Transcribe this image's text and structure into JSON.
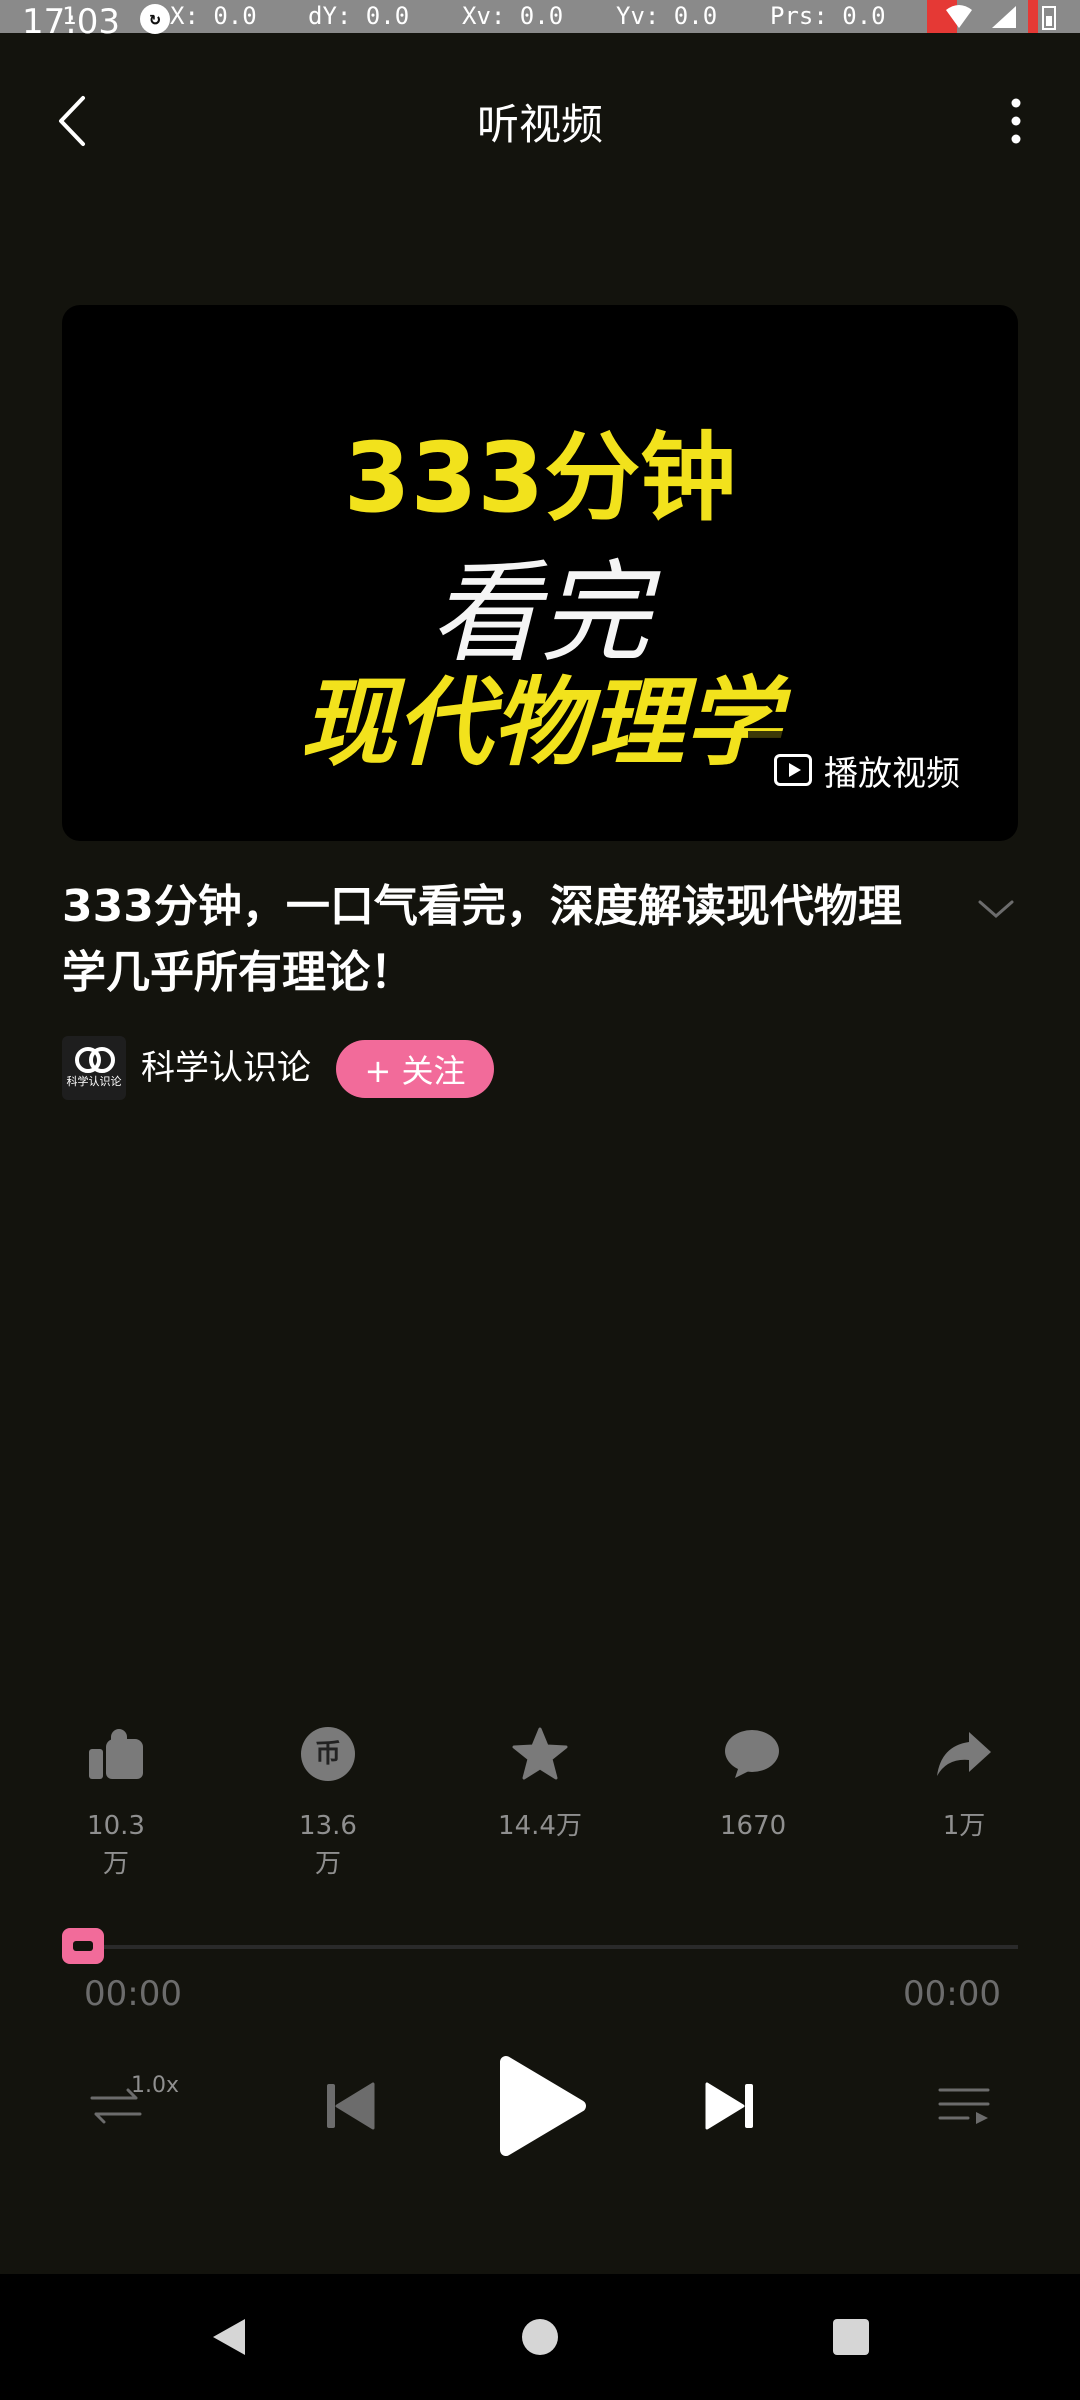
{
  "status_bar": {
    "time": "17:03",
    "pointer": "1",
    "dx": "X: 0.0",
    "dy": "dY: 0.0",
    "xv": "Xv: 0.0",
    "yv": "Yv: 0.0",
    "prs": "Prs: 0.0",
    "icons": [
      "notification-icon",
      "wifi-icon",
      "signal-icon",
      "battery-icon"
    ]
  },
  "header": {
    "title": "听视频",
    "back_icon": "chevron-left-icon",
    "more_icon": "more-vertical-icon"
  },
  "video": {
    "thumbnail_line1": "333分钟",
    "thumbnail_line2": "看完",
    "thumbnail_line3": "现代物理学",
    "play_video_label": "播放视频",
    "title": "333分钟，一口气看完，深度解读现代物理学几乎所有理论！"
  },
  "author": {
    "avatar_caption": "科学认识论",
    "name": "科学认识论",
    "follow_label": "+ 关注"
  },
  "actions": [
    {
      "name": "like",
      "icon": "thumbs-up-icon",
      "count": "10.3万"
    },
    {
      "name": "coin",
      "icon": "coin-icon",
      "glyph": "币",
      "count": "13.6万"
    },
    {
      "name": "favorite",
      "icon": "star-icon",
      "count": "14.4万"
    },
    {
      "name": "comment",
      "icon": "comment-icon",
      "count": "1670"
    },
    {
      "name": "share",
      "icon": "share-icon",
      "count": "1万"
    }
  ],
  "player": {
    "current_time": "00:00",
    "total_time": "00:00",
    "speed": "1.0x",
    "progress": 0,
    "controls": [
      "loop-icon",
      "previous-icon",
      "play-icon",
      "next-icon",
      "playlist-icon"
    ]
  },
  "colors": {
    "accent_pink": "#f26b9a",
    "thumbnail_yellow": "#f2e21c",
    "background": "#13130d"
  }
}
